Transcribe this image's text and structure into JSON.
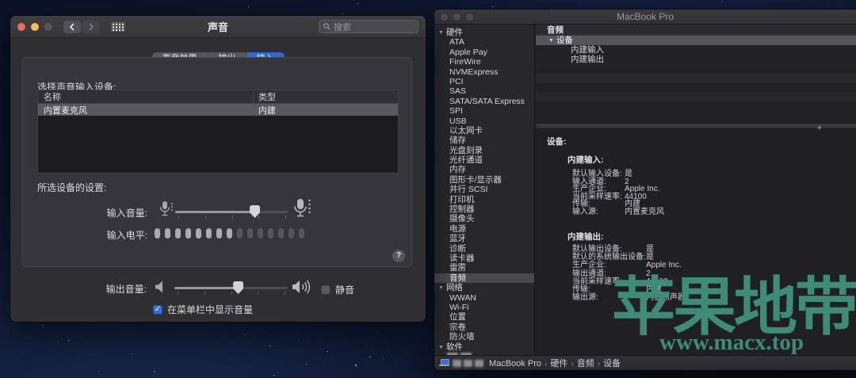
{
  "sound_window": {
    "title": "声音",
    "search_placeholder": "搜索",
    "tabs": [
      {
        "label": "声音效果",
        "selected": false
      },
      {
        "label": "输出",
        "selected": false
      },
      {
        "label": "输入",
        "selected": true
      }
    ],
    "input_devices": {
      "heading": "选择声音输入设备:",
      "columns": [
        "名称",
        "类型"
      ],
      "rows": [
        {
          "name": "内置麦克风",
          "type": "内建",
          "selected": true
        }
      ]
    },
    "settings_heading": "所选设备的设置:",
    "input_volume": {
      "label": "输入音量:",
      "value": 0.7
    },
    "input_level": {
      "label": "输入电平:",
      "segments": 15,
      "lit": 8
    },
    "output_volume": {
      "label": "输出音量:",
      "value": 0.56
    },
    "mute": {
      "label": "静音",
      "checked": false
    },
    "menu_bar_checkbox": {
      "label": "在菜单栏中显示音量",
      "checked": true,
      "checkmark": "✓"
    },
    "help_label": "?"
  },
  "sysinfo_window": {
    "title": "MacBook Pro",
    "sidebar": {
      "sections": [
        {
          "label": "硬件",
          "expanded": true,
          "selected_item": "音频",
          "items": [
            "ATA",
            "Apple Pay",
            "FireWire",
            "NVMExpress",
            "PCI",
            "SAS",
            "SATA/SATA Express",
            "SPI",
            "USB",
            "以太网卡",
            "储存",
            "光盘刻录",
            "光纤通道",
            "内存",
            "图形卡/显示器",
            "并行 SCSI",
            "打印机",
            "控制器",
            "摄像头",
            "电源",
            "蓝牙",
            "诊断",
            "读卡器",
            "雷雳",
            "音频"
          ]
        },
        {
          "label": "网络",
          "expanded": true,
          "selected_item": "",
          "items": [
            "WWAN",
            "Wi-Fi",
            "位置",
            "宗卷",
            "防火墙"
          ]
        },
        {
          "label": "软件",
          "expanded": true,
          "selected_item": "",
          "items": []
        }
      ]
    },
    "device_list": {
      "header": "音频",
      "group": "设备",
      "items": [
        "内建输入",
        "内建输出"
      ]
    },
    "details": {
      "heading": "设备:",
      "sections": [
        {
          "name": "内建输入:",
          "rows": [
            [
              "默认输入设备:",
              "是"
            ],
            [
              "输入通道:",
              "2"
            ],
            [
              "生产企业:",
              "Apple Inc."
            ],
            [
              "当前采样速率:",
              "44100"
            ],
            [
              "传输:",
              "内建"
            ],
            [
              "输入源:",
              "内置麦克风"
            ]
          ]
        },
        {
          "name": "内建输出:",
          "rows": [
            [
              "默认输出设备:",
              "是"
            ],
            [
              "默认的系统输出设备:",
              "是"
            ],
            [
              "生产企业:",
              "Apple Inc."
            ],
            [
              "输出通道:",
              "2"
            ],
            [
              "当前采样速率:",
              "44100"
            ],
            [
              "传输:",
              "内建"
            ],
            [
              "输出源:",
              "内置扬声器"
            ]
          ]
        }
      ]
    },
    "status_bar": {
      "breadcrumb": [
        "MacBook Pro",
        "硬件",
        "音频",
        "设备"
      ]
    }
  },
  "watermark": {
    "text": "苹果地带",
    "url": "www.macx.top",
    "color": "#3C8C78"
  }
}
